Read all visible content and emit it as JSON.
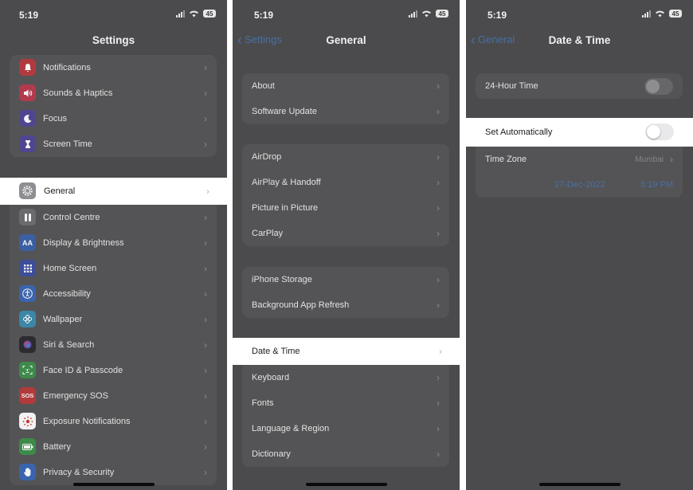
{
  "status": {
    "time": "5:19",
    "battery": "45"
  },
  "colors": {
    "dimmed_bg": "#4b4b4d",
    "highlight_bg": "#ffffff",
    "link_blue": "#4a6fa0"
  },
  "panel1": {
    "title": "Settings",
    "group1": [
      {
        "label": "Notifications",
        "icon": "bell-icon",
        "color": "#b13a3f"
      },
      {
        "label": "Sounds & Haptics",
        "icon": "speaker-icon",
        "color": "#b13a4c"
      },
      {
        "label": "Focus",
        "icon": "moon-icon",
        "color": "#4e4690"
      },
      {
        "label": "Screen Time",
        "icon": "hourglass-icon",
        "color": "#4e4690"
      }
    ],
    "general": {
      "label": "General",
      "icon": "gear-icon",
      "color": "#8e8e93"
    },
    "group2": [
      {
        "label": "Control Centre",
        "icon": "toggles-icon",
        "color": "#6b6b6e"
      },
      {
        "label": "Display & Brightness",
        "icon": "text-size-icon",
        "color": "#3a5fa2"
      },
      {
        "label": "Home Screen",
        "icon": "grid-icon",
        "color": "#3d4e9a"
      },
      {
        "label": "Accessibility",
        "icon": "accessibility-icon",
        "color": "#3a64ad"
      },
      {
        "label": "Wallpaper",
        "icon": "flower-icon",
        "color": "#3c86a8"
      },
      {
        "label": "Siri & Search",
        "icon": "siri-icon",
        "color": "#2c2c30"
      },
      {
        "label": "Face ID & Passcode",
        "icon": "face-id-icon",
        "color": "#3d8a4a"
      },
      {
        "label": "Emergency SOS",
        "icon": "sos-icon",
        "color": "#b23a3a",
        "text": "SOS"
      },
      {
        "label": "Exposure Notifications",
        "icon": "exposure-icon",
        "color": "#f2f2f2"
      },
      {
        "label": "Battery",
        "icon": "battery-icon",
        "color": "#3d8a4a"
      },
      {
        "label": "Privacy & Security",
        "icon": "hand-icon",
        "color": "#3a64ad"
      }
    ]
  },
  "panel2": {
    "back": "Settings",
    "title": "General",
    "group1": [
      "About",
      "Software Update"
    ],
    "group2": [
      "AirDrop",
      "AirPlay & Handoff",
      "Picture in Picture",
      "CarPlay"
    ],
    "group3": [
      "iPhone Storage",
      "Background App Refresh"
    ],
    "date_time": "Date & Time",
    "group4": [
      "Keyboard",
      "Fonts",
      "Language & Region",
      "Dictionary"
    ]
  },
  "panel3": {
    "back": "General",
    "title": "Date & Time",
    "hour24": {
      "label": "24-Hour Time",
      "on": false
    },
    "set_auto": {
      "label": "Set Automatically",
      "on": false
    },
    "time_zone": {
      "label": "Time Zone",
      "value": "Mumbai"
    },
    "date": "27-Dec-2022",
    "time": "5:19 PM"
  }
}
